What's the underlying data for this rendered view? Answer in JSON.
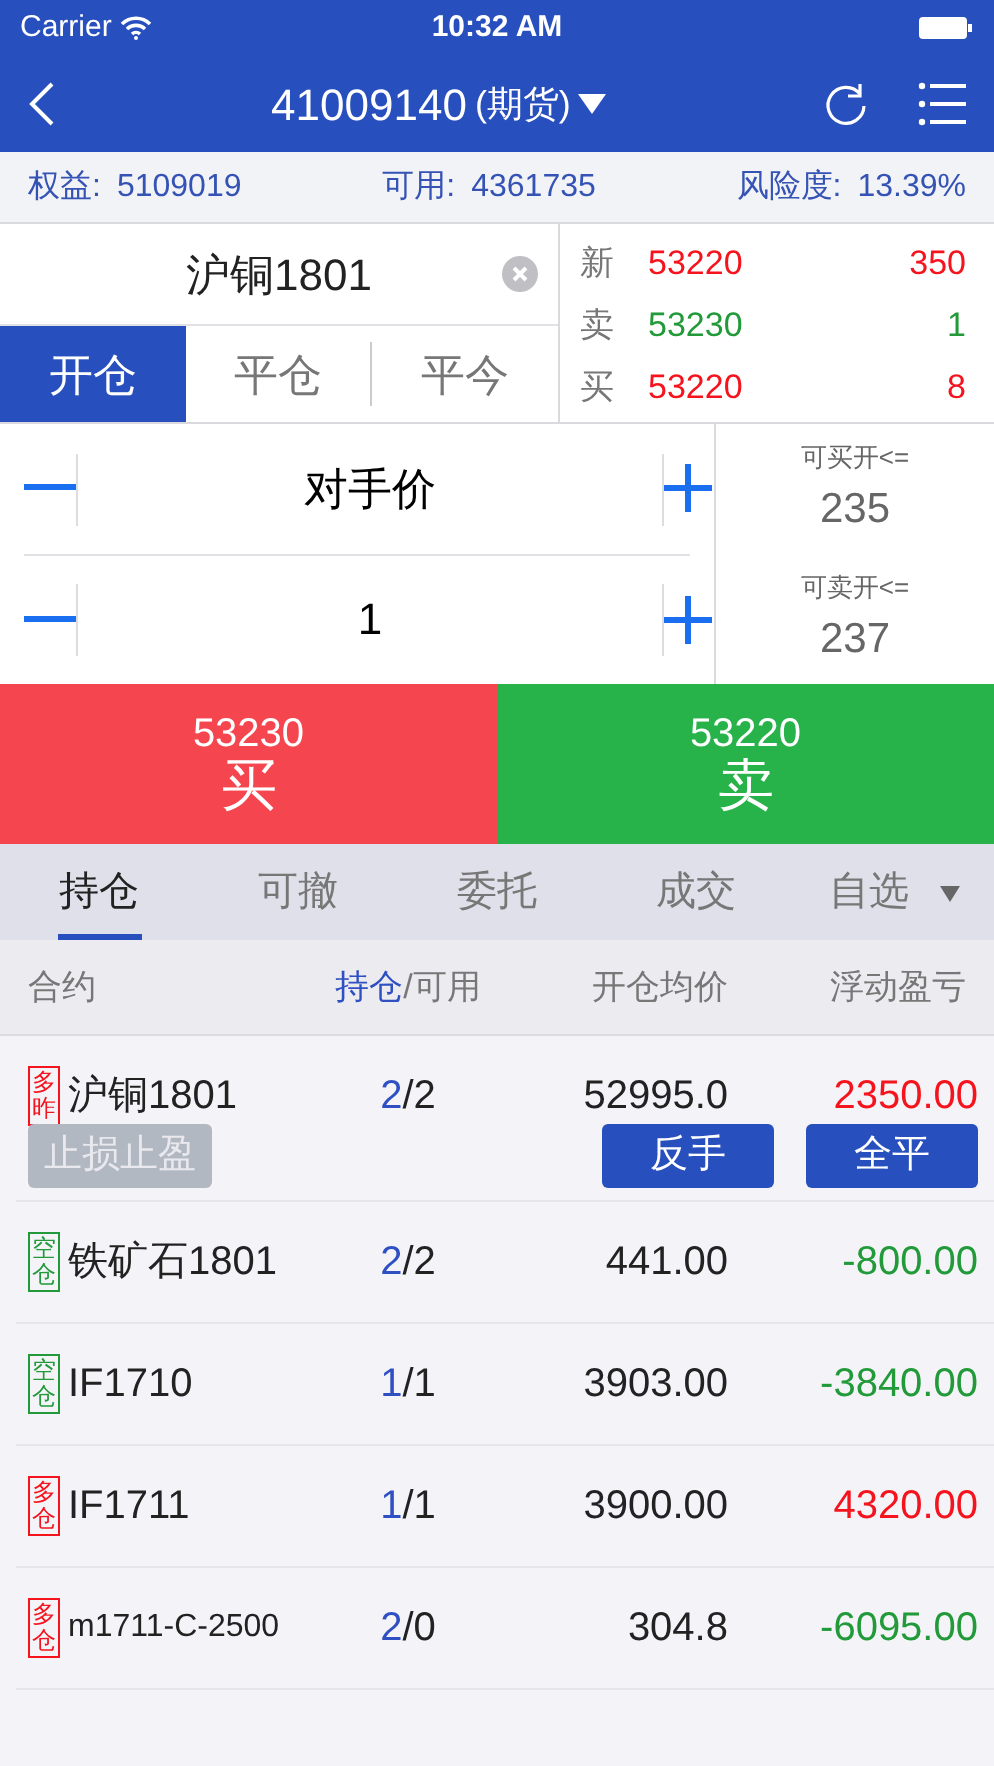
{
  "status_bar": {
    "carrier": "Carrier",
    "time": "10:32 AM"
  },
  "nav": {
    "account": "41009140",
    "type": "(期货)"
  },
  "account_info": [
    {
      "label": "权益:",
      "value": "5109019"
    },
    {
      "label": "可用:",
      "value": "4361735"
    },
    {
      "label": "风险度:",
      "value": "13.39%"
    }
  ],
  "contract": {
    "value": "沪铜1801"
  },
  "order_tabs": [
    {
      "label": "开仓",
      "selected": true
    },
    {
      "label": "平仓",
      "selected": false
    },
    {
      "label": "平今",
      "selected": false
    }
  ],
  "quotes": [
    {
      "label": "新",
      "price": "53220",
      "volume": "350",
      "color": "#f5141e"
    },
    {
      "label": "卖",
      "price": "53230",
      "volume": "1",
      "color": "#229a3a"
    },
    {
      "label": "买",
      "price": "53220",
      "volume": "8",
      "color": "#f5141e"
    }
  ],
  "price_field": {
    "value": "对手价"
  },
  "quantity_field": {
    "value": "1"
  },
  "limits": [
    {
      "label": "可买开<=",
      "value": "235"
    },
    {
      "label": "可卖开<=",
      "value": "237"
    }
  ],
  "trade_buttons": [
    {
      "kind": "buy",
      "price": "53230",
      "label": "买"
    },
    {
      "kind": "sell",
      "price": "53220",
      "label": "卖"
    }
  ],
  "position_tabs": [
    {
      "label": "持仓",
      "selected": true,
      "dropdown": false
    },
    {
      "label": "可撤",
      "selected": false,
      "dropdown": false
    },
    {
      "label": "委托",
      "selected": false,
      "dropdown": false
    },
    {
      "label": "成交",
      "selected": false,
      "dropdown": false
    },
    {
      "label": "自选",
      "selected": false,
      "dropdown": true
    }
  ],
  "columns": [
    {
      "label": "合约"
    },
    {
      "label": "持仓",
      "suffix": "/可用"
    },
    {
      "label": "开仓均价"
    },
    {
      "label": "浮动盈亏"
    }
  ],
  "positions": [
    {
      "badge": {
        "label": "多昨",
        "color": "#f5141e"
      },
      "contract": "沪铜1801",
      "hold": "2",
      "available": "/2",
      "avg_price": "52995.0",
      "pnl": "2350.00",
      "color": "#f5141e",
      "stop_button": {
        "label": "止损止盈",
        "disabled": true
      },
      "buttons": [
        "反手",
        "全平"
      ]
    },
    {
      "badge": {
        "label": "空仓",
        "color": "#229a3a"
      },
      "contract": "铁矿石1801",
      "hold": "2",
      "available": "/2",
      "avg_price": "441.00",
      "pnl": "-800.00",
      "color": "#229a3a"
    },
    {
      "badge": {
        "label": "空仓",
        "color": "#229a3a"
      },
      "contract": "IF1710",
      "hold": "1",
      "available": "/1",
      "avg_price": "3903.00",
      "pnl": "-3840.00",
      "color": "#229a3a"
    },
    {
      "badge": {
        "label": "多仓",
        "color": "#f5141e"
      },
      "contract": "IF1711",
      "hold": "1",
      "available": "/1",
      "avg_price": "3900.00",
      "pnl": "4320.00",
      "color": "#f5141e"
    },
    {
      "badge": {
        "label": "多仓",
        "color": "#f5141e"
      },
      "contract": "m1711-C-2500",
      "hold": "2",
      "available": "/0",
      "avg_price": "304.8",
      "pnl": "-6095.00",
      "color": "#229a3a"
    }
  ]
}
